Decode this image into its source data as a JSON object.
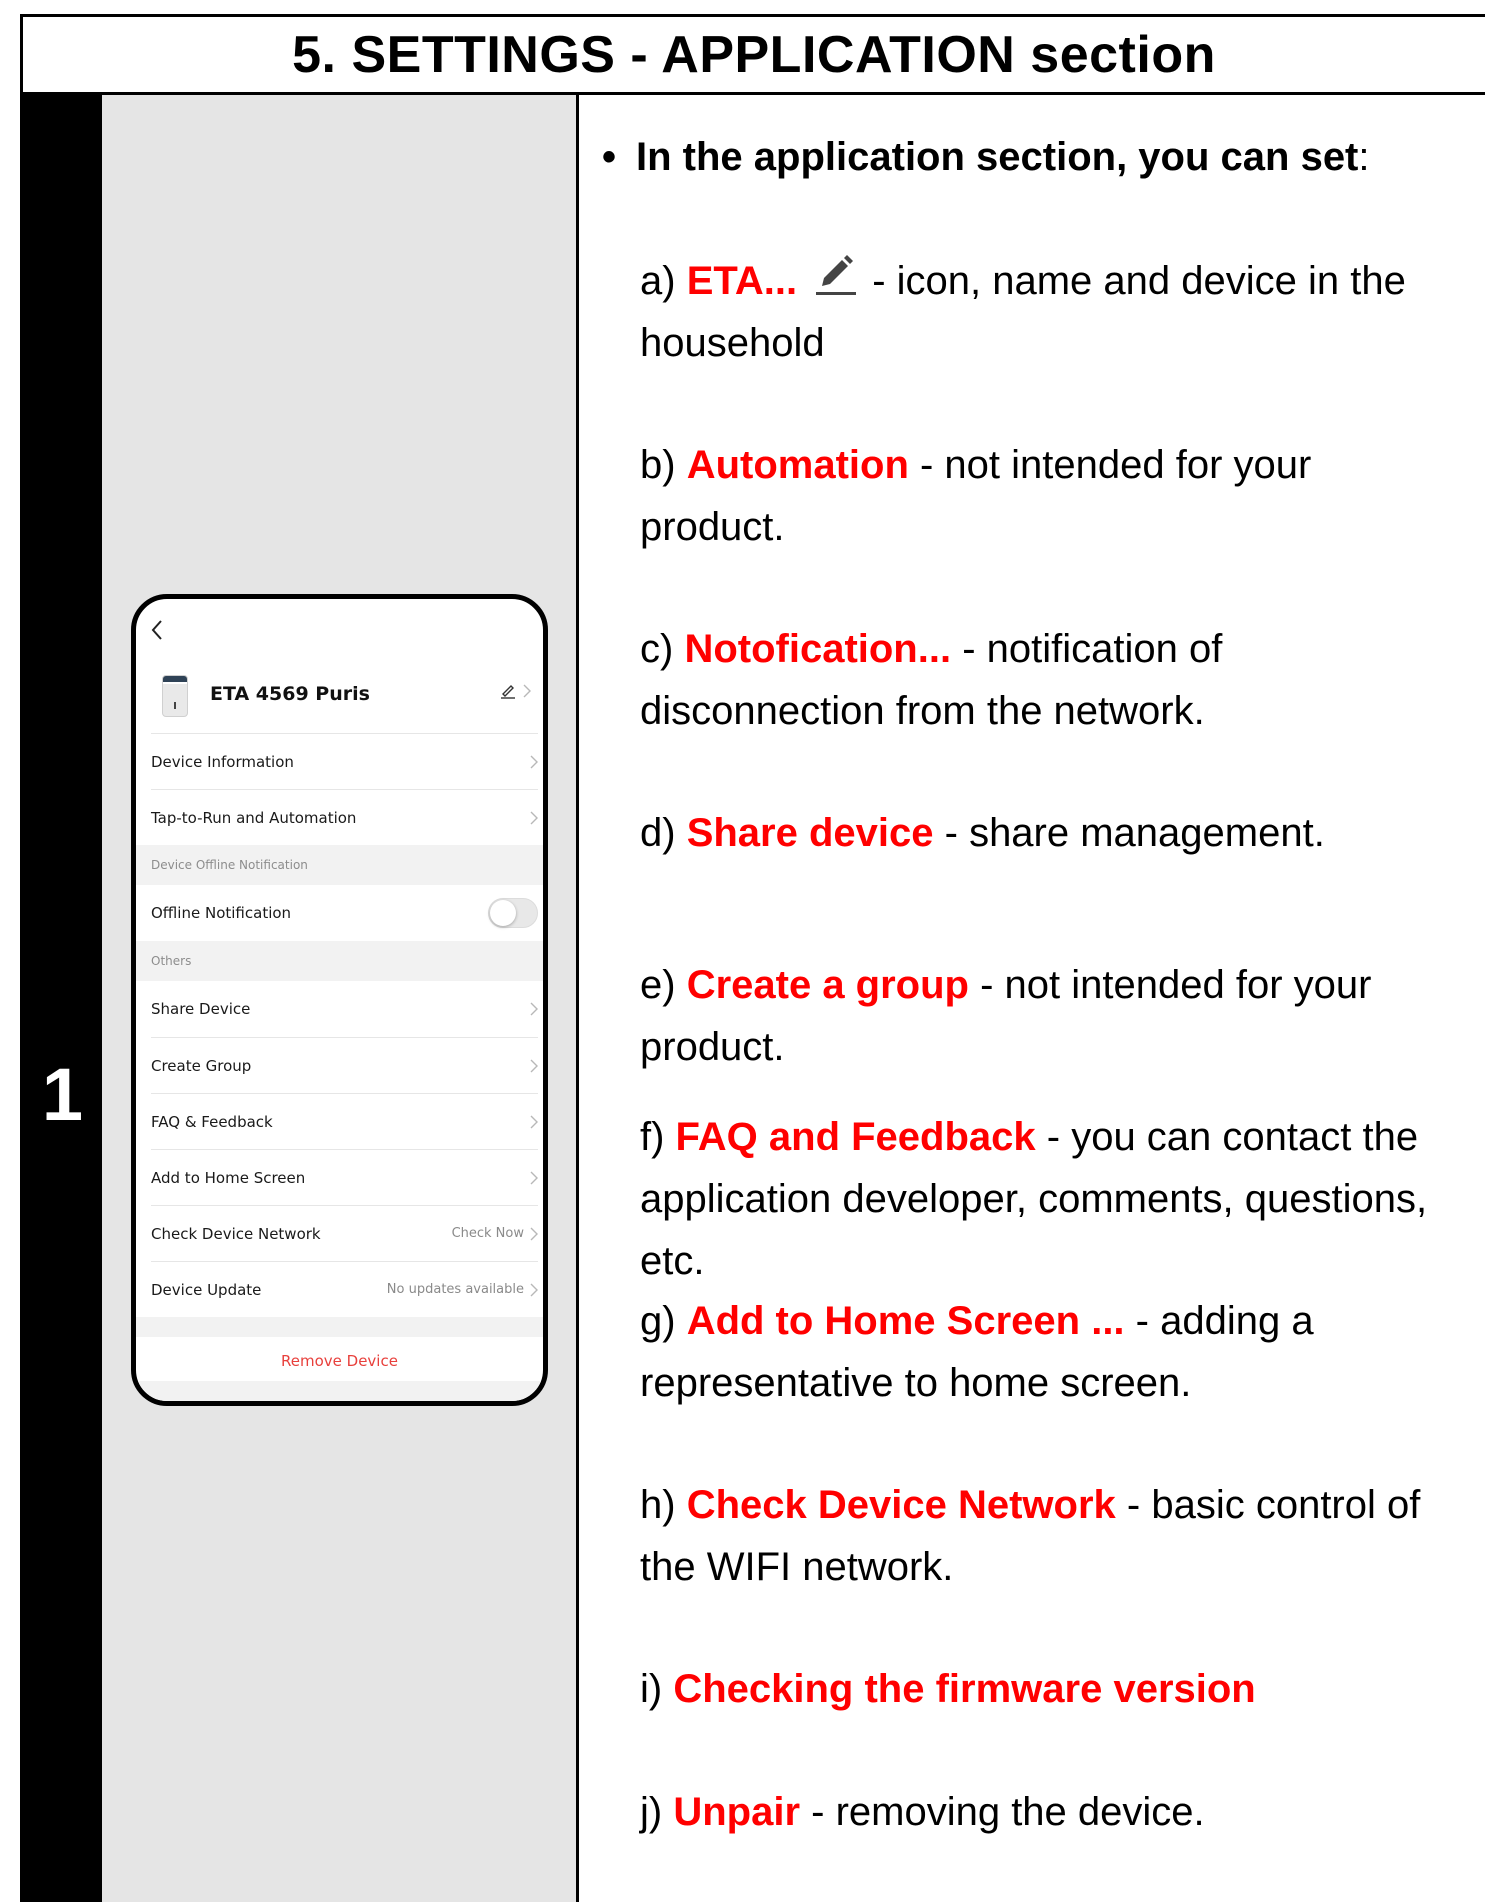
{
  "title": "5. SETTINGS - APPLICATION section",
  "step_number": "1",
  "phone": {
    "device_name": "ETA 4569 Puris",
    "rows_top": [
      {
        "label": "Device Information"
      },
      {
        "label": "Tap-to-Run and Automation"
      }
    ],
    "section_offline": "Device Offline Notification",
    "offline_label": "Offline Notification",
    "offline_enabled": false,
    "section_others": "Others",
    "rows_others": [
      {
        "label": "Share Device",
        "value": ""
      },
      {
        "label": "Create Group",
        "value": ""
      },
      {
        "label": "FAQ & Feedback",
        "value": ""
      },
      {
        "label": "Add to Home Screen",
        "value": ""
      },
      {
        "label": "Check Device Network",
        "value": "Check Now"
      },
      {
        "label": "Device Update",
        "value": "No updates available"
      }
    ],
    "remove_label": "Remove Device"
  },
  "intro": {
    "bullet": "•",
    "text": "In the application section, you can set",
    "colon": ":"
  },
  "items": [
    {
      "prefix": "a) ",
      "highlight": "ETA...",
      "icon": "pencil-icon",
      "rest": "- icon, name and device in the household"
    },
    {
      "prefix": "b) ",
      "highlight": "Automation",
      "rest": " - not intended for your product."
    },
    {
      "prefix": "c) ",
      "highlight": "Notofication...",
      "rest": " - notification of disconnection from the network."
    },
    {
      "prefix": "d) ",
      "highlight": "Share device",
      "rest": " - share management."
    },
    {
      "prefix": "e) ",
      "highlight": "Create a group",
      "rest": " - not intended for your product."
    },
    {
      "prefix": "f) ",
      "highlight": "FAQ and Feedback",
      "rest": " - you can contact the application developer, comments, questions, etc."
    },
    {
      "prefix": "g) ",
      "highlight": "Add to Home Screen ...",
      "rest": " - adding a representative to home screen."
    },
    {
      "prefix": "h) ",
      "highlight": "Check Device Network",
      "rest": " - basic control of the WIFI network."
    },
    {
      "prefix": "i) ",
      "highlight": "Checking the firmware version",
      "rest": ""
    },
    {
      "prefix": "j) ",
      "highlight": "Unpair",
      "rest": " - removing the device."
    }
  ],
  "colors": {
    "highlight": "#ff0000",
    "remove": "#e8403c",
    "panel_grey": "#e5e5e5"
  }
}
